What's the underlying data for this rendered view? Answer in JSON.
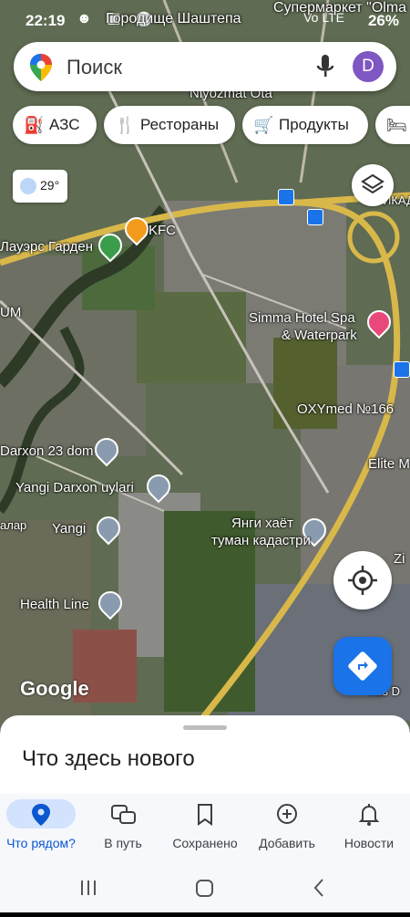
{
  "status_bar": {
    "time": "22:19",
    "notification": "Городище Шаштепа",
    "notification2": "Супермаркет \"Olma",
    "network": "Vo LTE",
    "battery": "26%"
  },
  "search": {
    "placeholder": "Поиск",
    "avatar_letter": "D",
    "avatar_color": "#7e57c2"
  },
  "chips": [
    {
      "label": "АЗС",
      "icon": "gas-station-icon"
    },
    {
      "label": "Рестораны",
      "icon": "restaurant-icon"
    },
    {
      "label": "Продукты",
      "icon": "cart-icon"
    },
    {
      "label": "",
      "icon": "hotel-icon"
    }
  ],
  "weather": {
    "temp": "29°",
    "icon": "partly-cloudy-icon"
  },
  "map_labels": {
    "niyozmat": "Niyozmat Ota",
    "kfc": "KFC",
    "flowers": "Лауэрс Гарден",
    "um": "UM",
    "simma": "Simma Hotel Spa",
    "waterpark": "& Waterpark",
    "oxymed": "OXYmed №166",
    "darxon23": "Darxon 23 dom",
    "yangi_darxon": "Yangi Darxon uylari",
    "elite": "Elite M",
    "yangi": "Yangi",
    "yangi_hayot1": "Янги хаёт",
    "yangi_hayot2": "туман кадастри",
    "health": "Health Line",
    "zi": "Zi",
    "ikad": "ИКАД",
    "alar": "алар",
    "nds": "nds D"
  },
  "google_logo": "Google",
  "sheet": {
    "title": "Что здесь нового"
  },
  "nav": [
    {
      "label": "Что рядом?",
      "icon": "location-pin-icon",
      "active": true
    },
    {
      "label": "В путь",
      "icon": "commute-icon",
      "active": false
    },
    {
      "label": "Сохранено",
      "icon": "bookmark-icon",
      "active": false
    },
    {
      "label": "Добавить",
      "icon": "add-circle-icon",
      "active": false
    },
    {
      "label": "Новости",
      "icon": "bell-icon",
      "active": false
    }
  ],
  "colors": {
    "accent": "#1a73e8",
    "active_pill": "#d3e3fd",
    "active_text": "#0b57d0"
  }
}
